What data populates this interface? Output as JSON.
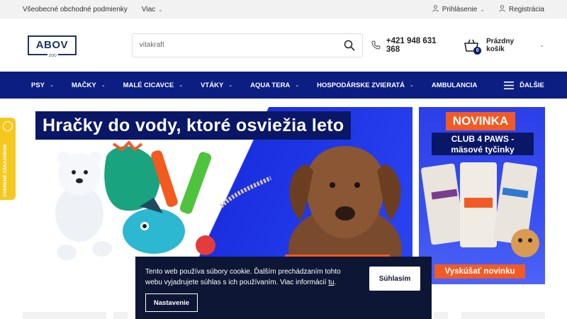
{
  "topbar": {
    "terms": "Všeobecné obchodné podmienky",
    "more": "Viac",
    "login": "Prihlásenie",
    "register": "Registrácia"
  },
  "header": {
    "logo": "ABOV",
    "logo_sub": "ZOO",
    "search_value": "vitakraft",
    "phone": "+421 948 631 368",
    "cart_label": "Prázdny košík",
    "cart_count": "0"
  },
  "nav": {
    "items": [
      "PSY",
      "MAČKY",
      "MALÉ CICAVCE",
      "VTÁKY",
      "AQUA TERA",
      "HOSPODÁRSKE ZVIERATÁ",
      "AMBULANCIA"
    ],
    "more": "ĎALŠIE"
  },
  "banner": {
    "title": "Hračky do vody, ktoré osviežia leto"
  },
  "side_banner": {
    "badge": "NOVINKA",
    "title_line1": "CLUB 4 PAWS -",
    "title_line2": "mäsové tyčinky",
    "button": "Vyskúšať novinku"
  },
  "side_tab": {
    "label": "OVERENÉ ZÁKAZNÍKMI"
  },
  "cookie": {
    "text": "Tento web používa súbory cookie. Ďalším prechádzaním tohto webu vyjadrujete súhlas s ich používaním. Viac informácií ",
    "link": "tu",
    "text_end": ".",
    "accept": "Súhlasím",
    "settings": "Nastavenie"
  },
  "colors": {
    "nav": "#0c1e82",
    "accent": "#f15a24",
    "navy": "#0a1766",
    "cookie_bg": "#0d1634"
  }
}
